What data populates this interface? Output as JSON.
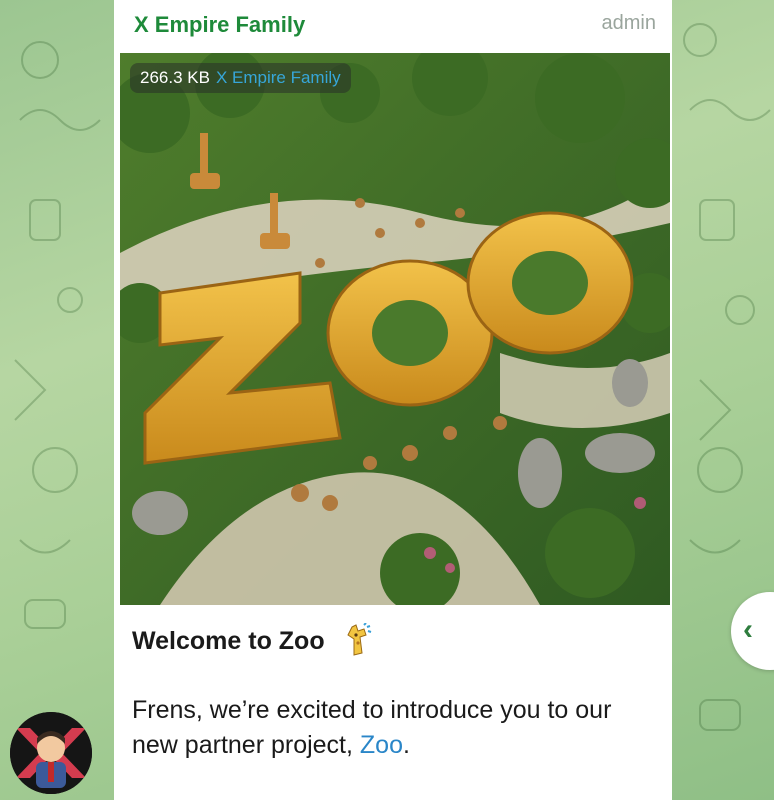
{
  "post": {
    "channel_name": "X Empire Family",
    "author_role": "admin",
    "media": {
      "file_size": "266.3 KB",
      "source_label": "X Empire Family",
      "image_text": "ZOO"
    },
    "title": "Welcome to Zoo",
    "title_icon": "giraffe-emoji-icon",
    "body_text": "Frens, we’re excited to introduce you to our new partner project, ",
    "body_link": "Zoo",
    "body_end": "."
  },
  "avatar_icon": "x-empire-avatar-icon",
  "navigation": {
    "back_icon": "chevron-left-icon",
    "back_glyph": "‹"
  },
  "colors": {
    "channel_name": "#1e8a3a",
    "link": "#2a86c8",
    "background": "#a9cf97",
    "size_source": "#37a6d8"
  }
}
